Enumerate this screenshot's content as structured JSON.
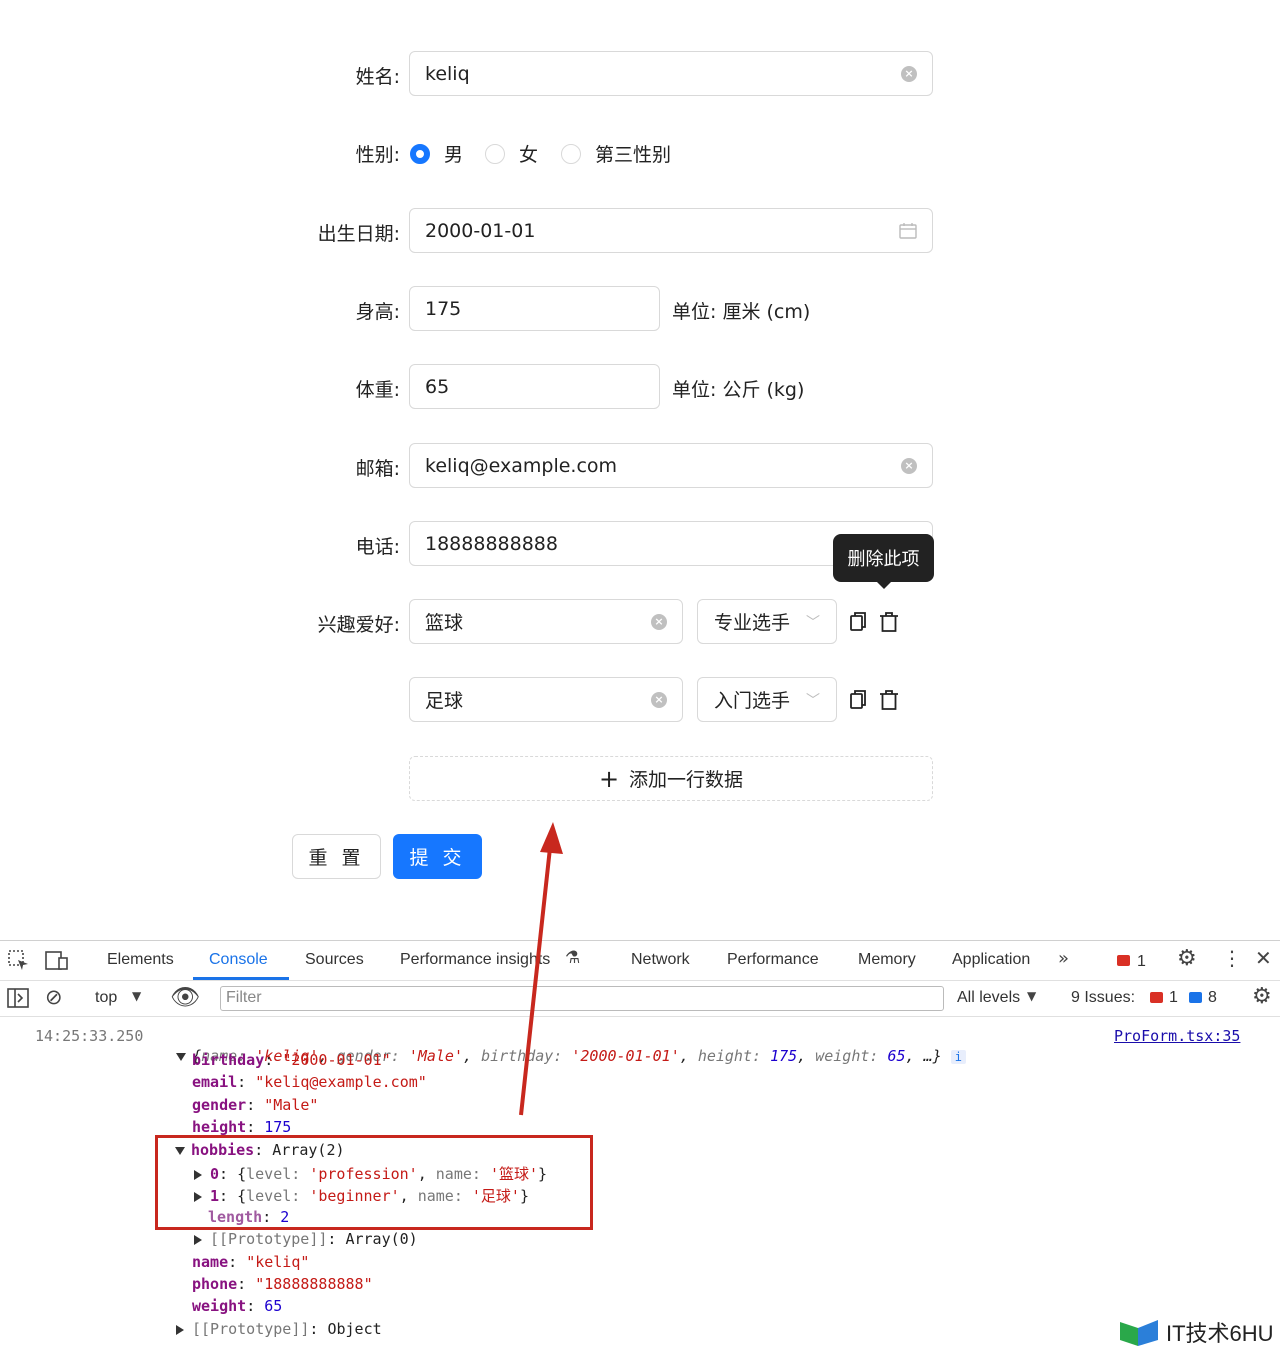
{
  "form": {
    "name": {
      "label": "姓名:",
      "value": "keliq"
    },
    "gender": {
      "label": "性别:",
      "options": [
        "男",
        "女",
        "第三性别"
      ],
      "selected": 0
    },
    "birthday": {
      "label": "出生日期:",
      "value": "2000-01-01"
    },
    "height": {
      "label": "身高:",
      "value": "175",
      "unit": "单位: 厘米 (cm)"
    },
    "weight": {
      "label": "体重:",
      "value": "65",
      "unit": "单位: 公斤 (kg)"
    },
    "email": {
      "label": "邮箱:",
      "value": "keliq@example.com"
    },
    "phone": {
      "label": "电话:",
      "value": "18888888888"
    },
    "hobbies": {
      "label": "兴趣爱好:",
      "rows": [
        {
          "name": "篮球",
          "level": "专业选手"
        },
        {
          "name": "足球",
          "level": "入门选手"
        }
      ],
      "tooltip": "删除此项",
      "add_label": "添加一行数据"
    },
    "reset_label": "重 置",
    "submit_label": "提 交"
  },
  "colors": {
    "primary": "#1677ff",
    "annotation": "#c8281e"
  },
  "devtools": {
    "tabs": [
      "Elements",
      "Console",
      "Sources",
      "Performance insights",
      "Network",
      "Performance",
      "Memory",
      "Application"
    ],
    "active_tab": "Console",
    "errors_count": "1",
    "context": "top",
    "filter_placeholder": "Filter",
    "levels": "All levels",
    "issues_label": "9 Issues:",
    "issues_errors": "1",
    "issues_info": "8",
    "log": {
      "timestamp": "14:25:33.250",
      "source": "ProForm.tsx:35",
      "summary": {
        "name": "'keliq'",
        "gender": "'Male'",
        "birthday": "'2000-01-01'",
        "height": "175",
        "weight": "65",
        "tail": ", …}"
      },
      "birthday": "\"2000-01-01\"",
      "email": "\"keliq@example.com\"",
      "gender": "\"Male\"",
      "height": "175",
      "hobbies_type": "Array(2)",
      "hobby0": {
        "level": "'profession'",
        "name": "'篮球'"
      },
      "hobby1": {
        "level": "'beginner'",
        "name": "'足球'"
      },
      "length": "2",
      "proto_array": "Array(0)",
      "name": "\"keliq\"",
      "phone": "\"18888888888\"",
      "weight": "65",
      "proto_object": "Object"
    }
  },
  "watermark": "IT技术6HU"
}
